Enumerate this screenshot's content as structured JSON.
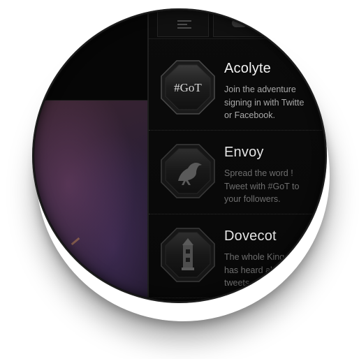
{
  "topbar": {
    "tabs": [
      {
        "icon": "menu-lines-icon"
      },
      {
        "icon": "chat-bubble-icon"
      }
    ]
  },
  "achievements": [
    {
      "title": "Acolyte",
      "badge_text": "#GoT",
      "badge_icon": "got-text-badge-icon",
      "description_lines": [
        "Join the adventure",
        "signing in with Twitte",
        "or Facebook."
      ]
    },
    {
      "title": "Envoy",
      "badge_icon": "raven-badge-icon",
      "description_lines": [
        "Spread the word !",
        "Tweet with #GoT to",
        "your followers."
      ]
    },
    {
      "title": "Dovecot",
      "badge_icon": "dovecote-tower-badge-icon",
      "description_lines": [
        "The whole Kingdo",
        "has heard abou",
        "tweets."
      ]
    }
  ],
  "colors": {
    "background": "#0a0a0a",
    "title_text": "#f2f2f2",
    "description_text": "#a9a9a9",
    "divider": "#2c2c2c"
  }
}
